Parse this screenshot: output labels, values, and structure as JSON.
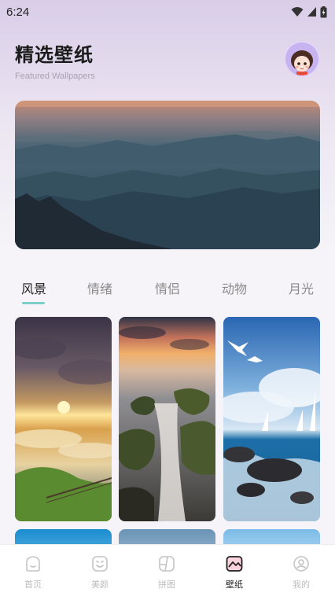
{
  "status_bar": {
    "time": "6:24"
  },
  "header": {
    "title": "精选壁纸",
    "subtitle": "Featured Wallpapers"
  },
  "categories": {
    "tabs": [
      {
        "label": "风景",
        "active": true
      },
      {
        "label": "情绪",
        "active": false
      },
      {
        "label": "情侣",
        "active": false
      },
      {
        "label": "动物",
        "active": false
      },
      {
        "label": "月光",
        "active": false
      }
    ],
    "accent_color": "#7ecfc9"
  },
  "wallpapers": [
    {
      "name": "sunset-clouds-hill"
    },
    {
      "name": "waterfall-rocks-sunset"
    },
    {
      "name": "seagulls-sailboats-sea"
    }
  ],
  "bottom_nav": {
    "items": [
      {
        "label": "首页",
        "icon": "home-icon",
        "active": false
      },
      {
        "label": "美颜",
        "icon": "beauty-face-icon",
        "active": false
      },
      {
        "label": "拼图",
        "icon": "collage-icon",
        "active": false
      },
      {
        "label": "壁纸",
        "icon": "wallpaper-icon",
        "active": true
      },
      {
        "label": "我的",
        "icon": "profile-icon",
        "active": false
      }
    ]
  }
}
